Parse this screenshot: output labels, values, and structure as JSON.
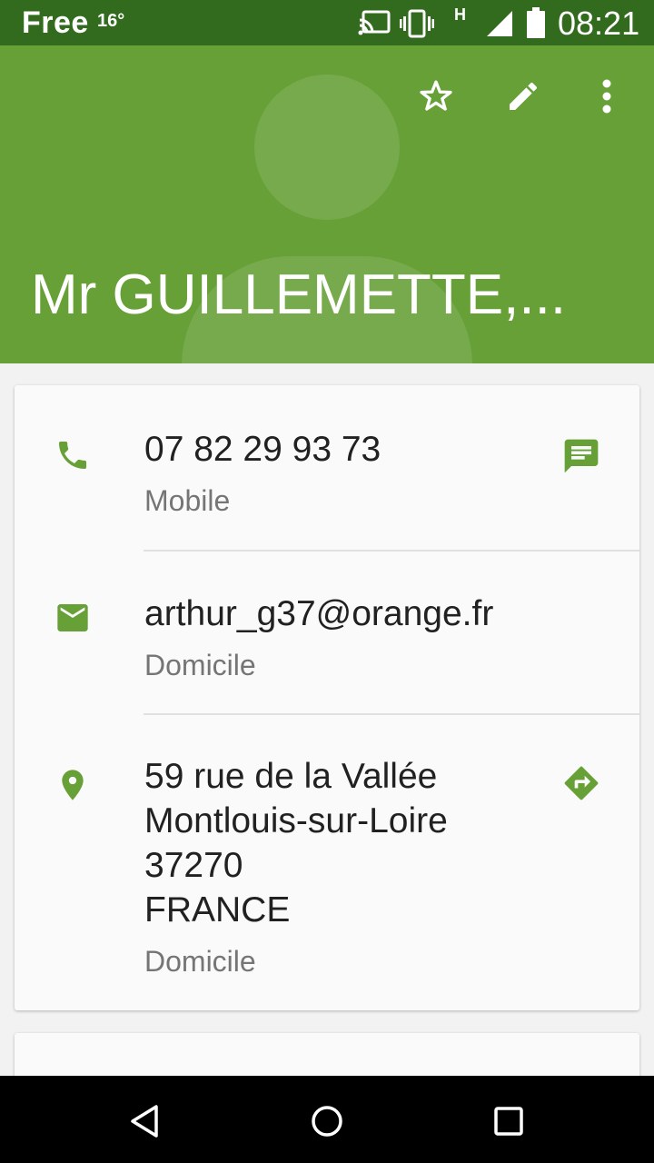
{
  "status_bar": {
    "carrier": "Free",
    "temperature": "16°",
    "network_type": "H",
    "time": "08:21",
    "icons": [
      "cast-icon",
      "vibrate-icon",
      "signal-icon",
      "battery-icon"
    ]
  },
  "header": {
    "contact_name": "Mr GUILLEMETTE,...",
    "background_color": "#67a037",
    "actions": [
      "star-icon",
      "edit-icon",
      "more-vert-icon"
    ]
  },
  "contact": {
    "phone": {
      "number": "07 82 29 93 73",
      "type": "Mobile",
      "icon": "phone-icon",
      "action_icon": "message-icon"
    },
    "email": {
      "address": "arthur_g37@orange.fr",
      "type": "Domicile",
      "icon": "email-icon"
    },
    "address": {
      "lines": [
        "59 rue de la Vallée",
        "Montlouis-sur-Loire",
        "37270",
        "FRANCE"
      ],
      "type": "Domicile",
      "icon": "location-icon",
      "action_icon": "directions-icon"
    }
  },
  "accent_color": "#67a037",
  "nav_bar": {
    "buttons": [
      "back-icon",
      "home-icon",
      "recents-icon"
    ]
  }
}
